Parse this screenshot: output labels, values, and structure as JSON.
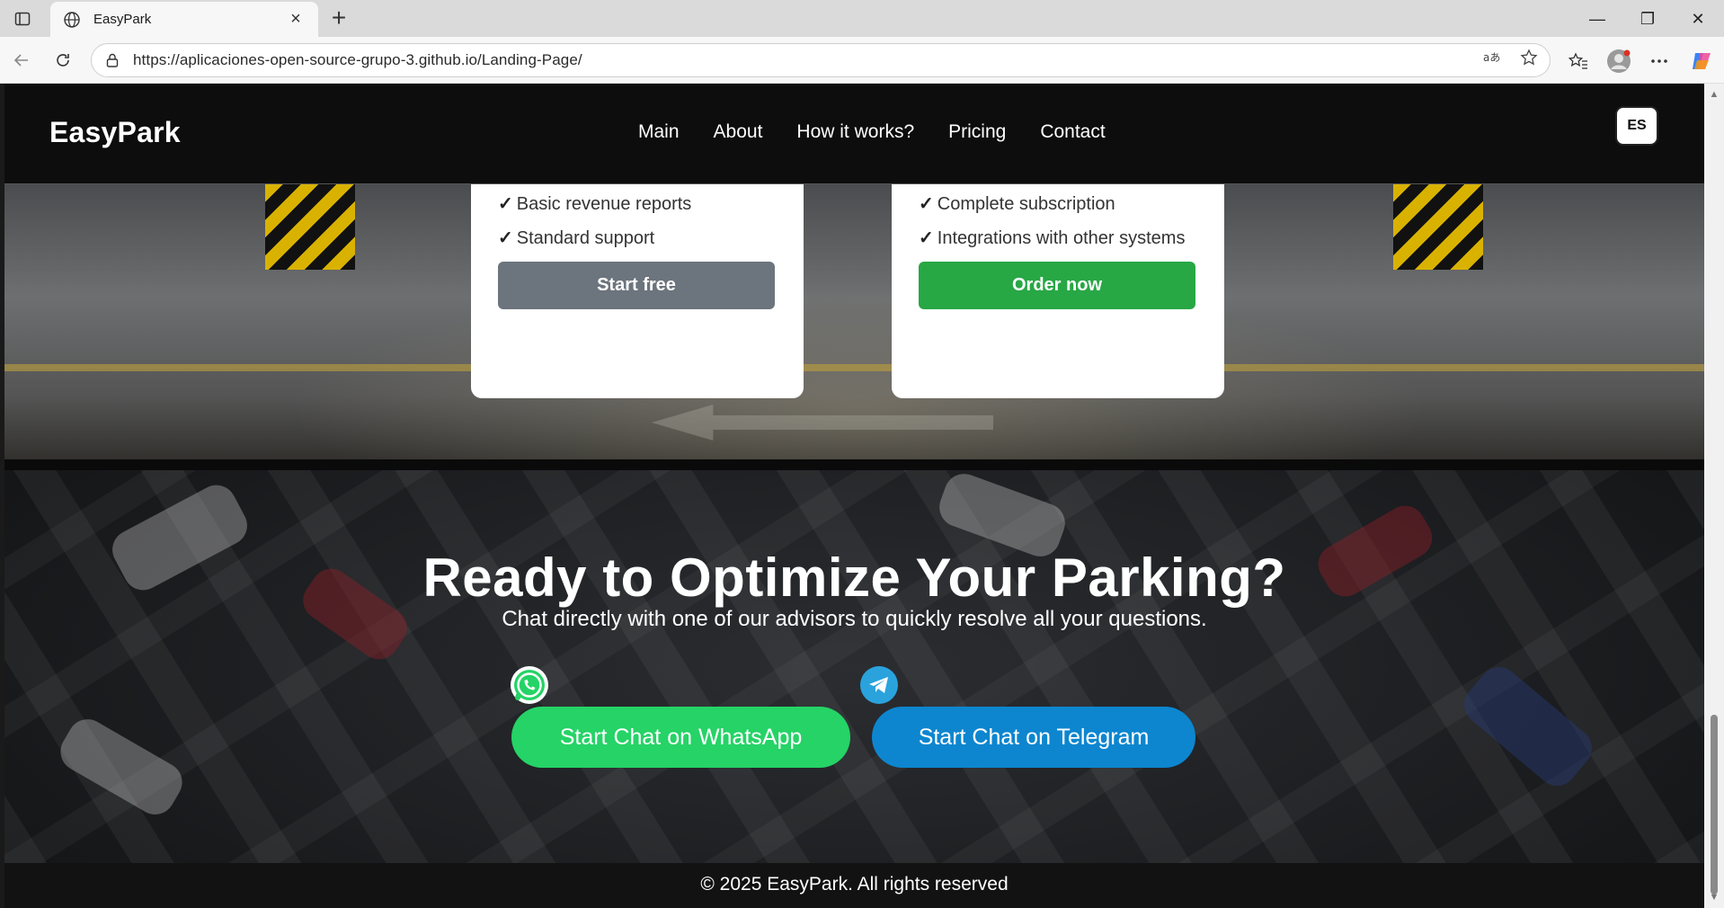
{
  "browser": {
    "tab_title": "EasyPark",
    "url": "https://aplicaciones-open-source-grupo-3.github.io/Landing-Page/",
    "new_tab_symbol": "+",
    "close_tab_symbol": "×",
    "window_controls": {
      "minimize": "—",
      "restore": "❐",
      "close": "✕"
    }
  },
  "header": {
    "logo": "EasyPark",
    "nav": [
      "Main",
      "About",
      "How it works?",
      "Pricing",
      "Contact"
    ],
    "language_button": "ES"
  },
  "pricing": {
    "basic_features": [
      "Basic revenue reports",
      "Standard support"
    ],
    "basic_cta": "Start free",
    "premium_features": [
      "Complete subscription",
      "Integrations with other systems"
    ],
    "premium_cta": "Order now",
    "check_symbol": "✓"
  },
  "cta_section": {
    "title": "Ready to Optimize Your Parking?",
    "subtitle": "Chat directly with one of our advisors to quickly resolve all your questions.",
    "whatsapp_button": "Start Chat on WhatsApp",
    "telegram_button": "Start Chat on Telegram"
  },
  "footer": {
    "copyright": "© 2025 EasyPark. All rights reserved"
  },
  "colors": {
    "whatsapp": "#25d366",
    "telegram": "#0d86cf",
    "order_green": "#28a745",
    "start_grey": "#6c747d"
  }
}
